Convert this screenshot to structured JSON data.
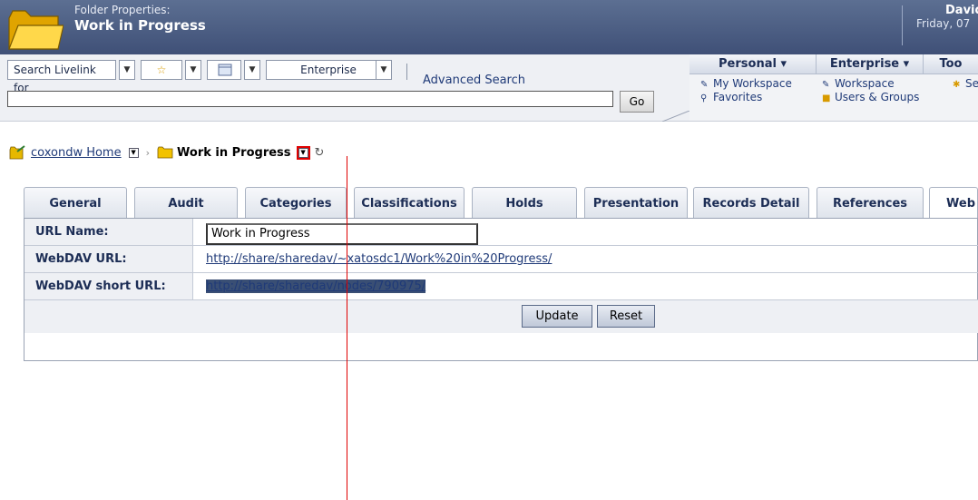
{
  "header": {
    "subtitle": "Folder Properties:",
    "title": "Work in Progress",
    "user": "David",
    "date": "Friday, 07"
  },
  "search": {
    "scope_label": "Search Livelink for",
    "location_label": "Enterprise",
    "advanced_label": "Advanced Search",
    "go_label": "Go",
    "query_value": ""
  },
  "nav": {
    "menus": [
      {
        "label": "Personal ▾"
      },
      {
        "label": "Enterprise ▾"
      },
      {
        "label": "Too"
      }
    ],
    "links": [
      {
        "label": "My Workspace",
        "icon": "workspace-icon"
      },
      {
        "label": "Favorites",
        "icon": "favorites-icon"
      },
      {
        "label": "Workspace",
        "icon": "workspace-icon"
      },
      {
        "label": "Users & Groups",
        "icon": "users-groups-icon"
      },
      {
        "label": "Se",
        "icon": "settings-icon"
      }
    ]
  },
  "breadcrumb": {
    "home_label": "coxondw Home",
    "current_label": "Work in Progress"
  },
  "tabs": [
    {
      "label": "General"
    },
    {
      "label": "Audit"
    },
    {
      "label": "Categories"
    },
    {
      "label": "Classifications"
    },
    {
      "label": "Holds"
    },
    {
      "label": "Presentation"
    },
    {
      "label": "Records Detail"
    },
    {
      "label": "References"
    },
    {
      "label": "Web"
    }
  ],
  "properties": {
    "url_name_label": "URL Name:",
    "url_name_value": "Work in Progress",
    "webdav_url_label": "WebDAV URL:",
    "webdav_url_value": "http://share/sharedav/~xatosdc1/Work%20in%20Progress/",
    "webdav_short_label": "WebDAV short URL:",
    "webdav_short_value": "http://share/sharedav/nodes/790975/"
  },
  "buttons": {
    "update_label": "Update",
    "reset_label": "Reset"
  },
  "colors": {
    "header": "#4a5b80",
    "highlight": "#e00000",
    "link": "#1f3a78",
    "selection": "#3a4f74"
  }
}
